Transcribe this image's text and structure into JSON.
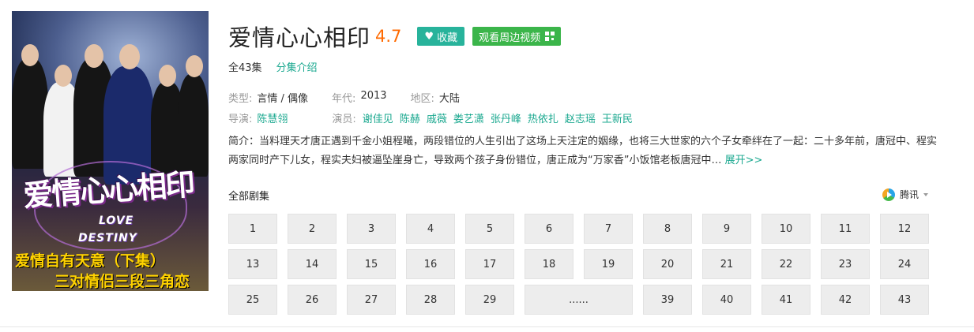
{
  "poster": {
    "title_art": "爱情心心相印",
    "subtitle_art_1": "LOVE",
    "subtitle_art_2": "DESTINY",
    "tagline_1": "爱情自有天意（下集）",
    "tagline_2": "三对情侣三段三角恋"
  },
  "header": {
    "title": "爱情心心相印",
    "score": "4.7",
    "favorite_label": "收藏",
    "watch_video_label": "观看周边视频"
  },
  "episodes_info": {
    "total": "全43集",
    "intro_link": "分集介绍"
  },
  "meta": {
    "type_label": "类型:",
    "type_value": "言情 / 偶像",
    "year_label": "年代:",
    "year_value": "2013",
    "region_label": "地区:",
    "region_value": "大陆",
    "director_label": "导演:",
    "director_value": "陈慧翎",
    "cast_label": "演员:",
    "cast": [
      "谢佳见",
      "陈赫",
      "戚薇",
      "娄艺潇",
      "张丹峰",
      "热依扎",
      "赵志瑶",
      "王新民"
    ]
  },
  "synopsis": {
    "text": "简介：当料理天才唐正遇到千金小姐程曦，两段错位的人生引出了这场上天注定的姻缘，也将三大世家的六个子女牵绊在了一起：二十多年前，唐冠中、程实两家同时产下儿女，程实夫妇被逼坠崖身亡，导致两个孩子身份错位，唐正成为“万家香”小饭馆老板唐冠中…",
    "expand_label": "展开>>"
  },
  "episode_list": {
    "heading": "全部剧集",
    "source_label": "腾讯",
    "row1": [
      "1",
      "2",
      "3",
      "4",
      "5",
      "6",
      "7",
      "8",
      "9",
      "10",
      "11",
      "12"
    ],
    "row2": [
      "13",
      "14",
      "15",
      "16",
      "17",
      "18",
      "19",
      "20",
      "21",
      "22",
      "23",
      "24"
    ],
    "row3": [
      "25",
      "26",
      "27",
      "28",
      "29",
      "......",
      "39",
      "40",
      "41",
      "42",
      "43"
    ]
  },
  "colors": {
    "accent": "#28b39b",
    "watch_green": "#3bb54a",
    "score_orange": "#ff6a00",
    "link": "#1aa88f"
  }
}
